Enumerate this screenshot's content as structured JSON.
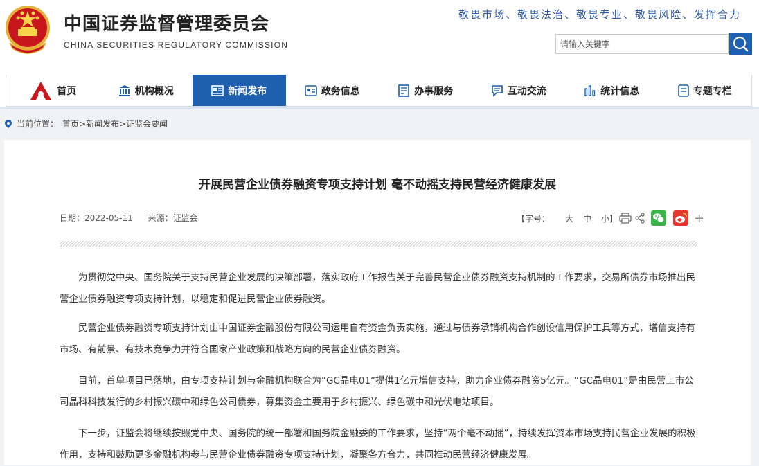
{
  "header": {
    "title_cn": "中国证券监督管理委员会",
    "title_en": "CHINA SECURITIES REGULATORY COMMISSION",
    "slogan": "敬畏市场、敬畏法治、敬畏专业、敬畏风险、发挥合力",
    "search_placeholder": "请输入关键字"
  },
  "nav": {
    "items": [
      {
        "label": "首页",
        "icon": "logo-icon"
      },
      {
        "label": "机构概况",
        "icon": "building-icon"
      },
      {
        "label": "新闻发布",
        "icon": "newspaper-icon"
      },
      {
        "label": "政务信息",
        "icon": "info-card-icon"
      },
      {
        "label": "办事服务",
        "icon": "form-icon"
      },
      {
        "label": "互动交流",
        "icon": "chat-icon"
      },
      {
        "label": "统计信息",
        "icon": "bar-chart-icon"
      },
      {
        "label": "专题专栏",
        "icon": "document-icon"
      }
    ],
    "active_index": 2,
    "active_color": "#1f5fb0"
  },
  "breadcrumb": {
    "prefix": "当前位置：",
    "path": [
      "首页",
      "新闻发布",
      "证监会要闻"
    ]
  },
  "article": {
    "title": "开展民营企业债券融资专项支持计划 毫不动摇支持民营经济健康发展",
    "date_label": "日期：2022-05-11",
    "source_label": "来源：证监会",
    "font_size_label": "【字号：",
    "font_sizes": [
      "大",
      "中",
      "小】"
    ],
    "paragraphs": [
      "为贯彻党中央、国务院关于支持民营企业发展的决策部署，落实政府工作报告关于完善民营企业债券融资支持机制的工作要求，交易所债券市场推出民营企业债券融资专项支持计划，以稳定和促进民营企业债券融资。",
      "民营企业债券融资专项支持计划由中国证券金融股份有限公司运用自有资金负责实施，通过与债券承销机构合作创设信用保护工具等方式，增信支持有市场、有前景、有技术竞争力并符合国家产业政策和战略方向的民营企业债券融资。",
      "目前，首单项目已落地，由专项支持计划与金融机构联合为“GC晶电01”提供1亿元增信支持，助力企业债券融资5亿元。“GC晶电01”是由民营上市公司晶科科技发行的乡村振兴碳中和绿色公司债券，募集资金主要用于乡村振兴、绿色碳中和光伏电站项目。",
      "下一步，证监会将继续按照党中央、国务院的统一部署和国务院金融委的工作要求，坚持“两个毫不动摇”，持续发挥资本市场支持民营企业发展的积极作用，支持和鼓励更多金融机构参与民营企业债券融资专项支持计划，凝聚各方合力，共同推动民营经济健康发展。"
    ],
    "share_more": "+"
  },
  "colors": {
    "brand_blue": "#1f5fb0",
    "slogan_blue": "#2d57a7",
    "wechat_green": "#3bb44a",
    "weibo_red": "#e6372e"
  }
}
